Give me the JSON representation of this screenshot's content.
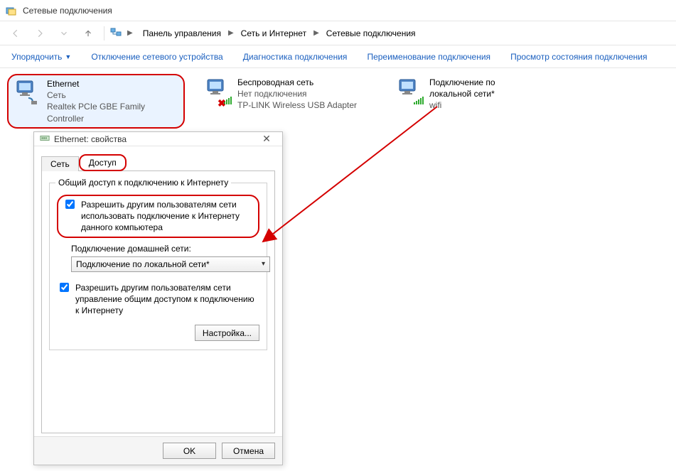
{
  "window": {
    "title": "Сетевые подключения"
  },
  "breadcrumbs": {
    "items": [
      "Панель управления",
      "Сеть и Интернет",
      "Сетевые подключения"
    ]
  },
  "commands": {
    "organize": "Упорядочить",
    "disable": "Отключение сетевого устройства",
    "diagnose": "Диагностика подключения",
    "rename": "Переименование подключения",
    "status": "Просмотр состояния подключения"
  },
  "connections": {
    "ethernet": {
      "name": "Ethernet",
      "status": "Сеть",
      "device": "Realtek PCIe GBE Family Controller"
    },
    "wireless": {
      "name": "Беспроводная сеть",
      "status": "Нет подключения",
      "device": "TP-LINK Wireless USB Adapter"
    },
    "local": {
      "name": "Подключение по локальной сети*",
      "status": "wifi"
    }
  },
  "dialog": {
    "title": "Ethernet: свойства",
    "tabs": {
      "network": "Сеть",
      "access": "Доступ"
    },
    "group_legend": "Общий доступ к подключению к Интернету",
    "chk_share": "Разрешить другим пользователям сети использовать подключение к Интернету данного компьютера",
    "home_label": "Подключение домашней сети:",
    "home_value": "Подключение по локальной сети*",
    "chk_control": "Разрешить другим пользователям сети управление общим доступом к подключению к Интернету",
    "btn_settings": "Настройка...",
    "btn_ok": "OK",
    "btn_cancel": "Отмена"
  }
}
